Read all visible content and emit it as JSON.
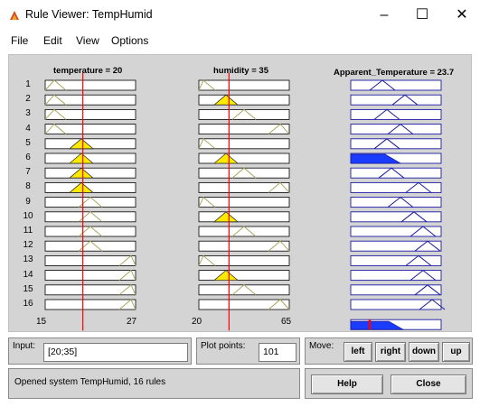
{
  "window": {
    "title": "Rule Viewer: TempHumid",
    "minimize_glyph": "–",
    "maximize_glyph": "☐",
    "close_glyph": "✕",
    "icon": "matlab-icon"
  },
  "menu": {
    "items": [
      "File",
      "Edit",
      "View",
      "Options"
    ]
  },
  "plots": {
    "inputs": [
      {
        "header": "temperature = 20",
        "range_min": "15",
        "range_max": "27"
      },
      {
        "header": "humidity = 35",
        "range_min": "20",
        "range_max": "65"
      }
    ],
    "output": {
      "header": "Apparent_Temperature = 23.7"
    },
    "rule_numbers": [
      "1",
      "2",
      "3",
      "4",
      "5",
      "6",
      "7",
      "8",
      "9",
      "10",
      "11",
      "12",
      "13",
      "14",
      "15",
      "16"
    ],
    "input_value_line_fraction": [
      0.4167,
      0.3333
    ],
    "output_aggregate_fraction": 0.21,
    "temperature_mf_peak_fraction": [
      0.1,
      0.1,
      0.1,
      0.1,
      0.4,
      0.4,
      0.4,
      0.4,
      0.5,
      0.5,
      0.5,
      0.5,
      0.95,
      0.95,
      0.95,
      0.95
    ],
    "humidity_mf_peak_fraction": [
      0.05,
      0.3,
      0.5,
      0.9,
      0.05,
      0.3,
      0.5,
      0.9,
      0.05,
      0.3,
      0.5,
      0.9,
      0.05,
      0.3,
      0.5,
      0.9
    ],
    "output_mf_peak_fraction": [
      0.35,
      0.6,
      0.4,
      0.55,
      0.4,
      0.3,
      0.45,
      0.75,
      0.55,
      0.7,
      0.8,
      0.85,
      0.75,
      0.8,
      0.85,
      0.9
    ],
    "fired_input_rows_temperature": [
      5,
      6,
      7,
      8
    ],
    "fired_input_rows_humidity": [
      2,
      6,
      10,
      14
    ],
    "fired_output_rows": [
      6
    ],
    "colors": {
      "mf_line": "#a8a860",
      "output_line": "#1a1aa0",
      "fill_yellow": "#ffea00",
      "fill_blue": "#1a3cff",
      "value_line": "#ff0000",
      "panel_bg": "#d4d4d4"
    }
  },
  "controls": {
    "input_label": "Input:",
    "input_value": "[20;35]",
    "plot_points_label": "Plot points:",
    "plot_points_value": "101",
    "move_label": "Move:",
    "move_buttons": [
      "left",
      "right",
      "down",
      "up"
    ],
    "status": "Opened system TempHumid, 16 rules",
    "help_label": "Help",
    "close_label": "Close"
  }
}
